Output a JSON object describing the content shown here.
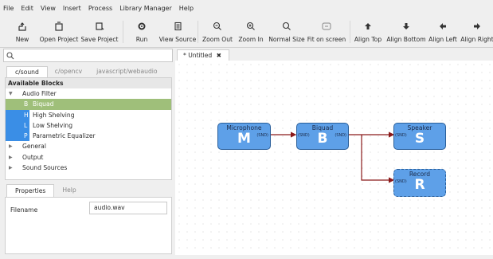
{
  "menu": [
    "File",
    "Edit",
    "View",
    "Insert",
    "Process",
    "Library Manager",
    "Help"
  ],
  "toolbar": {
    "new": "New",
    "open_project": "Open Project",
    "save_project": "Save Project",
    "run": "Run",
    "view_source": "View Source",
    "zoom_out": "Zoom Out",
    "zoom_in": "Zoom In",
    "normal_size": "Normal Size",
    "fit_on_screen": "Fit on screen",
    "align_top": "Align Top",
    "align_bottom": "Align Bottom",
    "align_left": "Align Left",
    "align_right": "Align Right"
  },
  "library_tabs": [
    "c/sound",
    "c/opencv",
    "javascript/webaudio"
  ],
  "blocks": {
    "header": "Available Blocks",
    "audio_filter": "Audio Filter",
    "items": [
      {
        "key": "B",
        "label": "Biquad"
      },
      {
        "key": "H",
        "label": "High Shelving"
      },
      {
        "key": "L",
        "label": "Low Shelving"
      },
      {
        "key": "P",
        "label": "Parametric Equalizer"
      }
    ],
    "groups": [
      "General",
      "Output",
      "Sound Sources"
    ]
  },
  "properties": {
    "tabs": [
      "Properties",
      "Help"
    ],
    "filename_label": "Filename",
    "filename_value": "audio.wav"
  },
  "document_tab": "* Untitled",
  "nodes": {
    "microphone": {
      "name": "Microphone",
      "letter": "M",
      "out": "(SND)"
    },
    "biquad": {
      "name": "Biquad",
      "letter": "B",
      "in": "(SND)",
      "out": "(SND)"
    },
    "speaker": {
      "name": "Speaker",
      "letter": "S",
      "in": "(SND)"
    },
    "record": {
      "name": "Record",
      "letter": "R",
      "in": "(SND)"
    }
  },
  "colors": {
    "node": "#5ea0e8",
    "selected_row": "#9fbf7a",
    "leaf_key": "#3a8ee6",
    "wire": "#8b1a1a"
  }
}
